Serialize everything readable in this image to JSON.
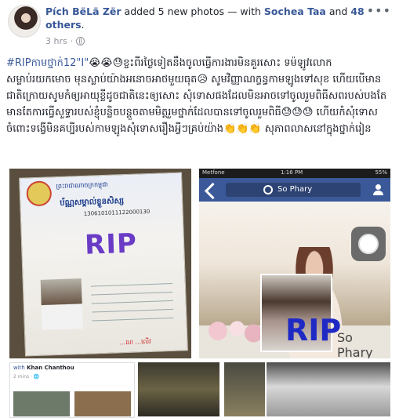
{
  "post": {
    "author": "Pích BëLä Zër",
    "action": " added 5 new photos — with ",
    "tagged": "Sochea Taa",
    "and_text": " and ",
    "others": "48 others",
    "period": ".",
    "time": "3 hrs",
    "dot": "·",
    "more_label": "•••",
    "hashtag": "#RIPកាមថ្នាក់12\"I\"",
    "emojis_line1": "😭😭😓",
    "body": "ខ្ចះពីរថ្ងៃទៀតនឹងចូលធ្វើការងារមិនគួរសោះ ទម៉ឡូវលោកសម្លាប់រយកមោច មុនស្លាប់យ៉ាងអនោចអាថមួយធុត😥 សូមវិញ្ញាណក្ខន្ធកាមឡូងទៅសុខ ហើយបើមានជាតិក្រោយសូមកំឲ្យអាយុខ្លីដូចជាតិនេះឲ្យសោះ សុំទោសផងដែលមិនអាចទៅចូលរួមពិធីសពរបស់បងតែមានតែការធ្វើសួទ្ធារបស់ខ្ញុំបន្លិចបន្តួចតាមមិត្តរួមថ្នាក់ដែលបានទៅចូលរួមពិធី😓😓😓 ហើយកំសុំទោសចំពោះទង្វើមិនគប្បីរបស់កាមឡូងសុំទោសរឿងអ្វីៗគ្រប់យ៉ាង👏👏👏 សុភាពលាសនៅក្នុងថ្នាក់រៀន"
  },
  "photo1": {
    "header_small": "ព្រះរាជាណាចក្រកម្ពុជា",
    "card_title": "ប័ណ្ណសម្គាល់ខ្លួនសិស្ស",
    "card_number": "1306101011122000130",
    "overlay": "RIP",
    "stamp_text": "...ណ ...លើវ"
  },
  "photo2": {
    "carrier": "Metfone",
    "time": "1:16 PM",
    "battery": "55%",
    "search_query": "So Phary",
    "overlay": "RIP",
    "page_name": "So Phary"
  },
  "thumb1": {
    "name": "Khan Chanthou",
    "with": "with ",
    "time": "2 mins · 🌐"
  }
}
